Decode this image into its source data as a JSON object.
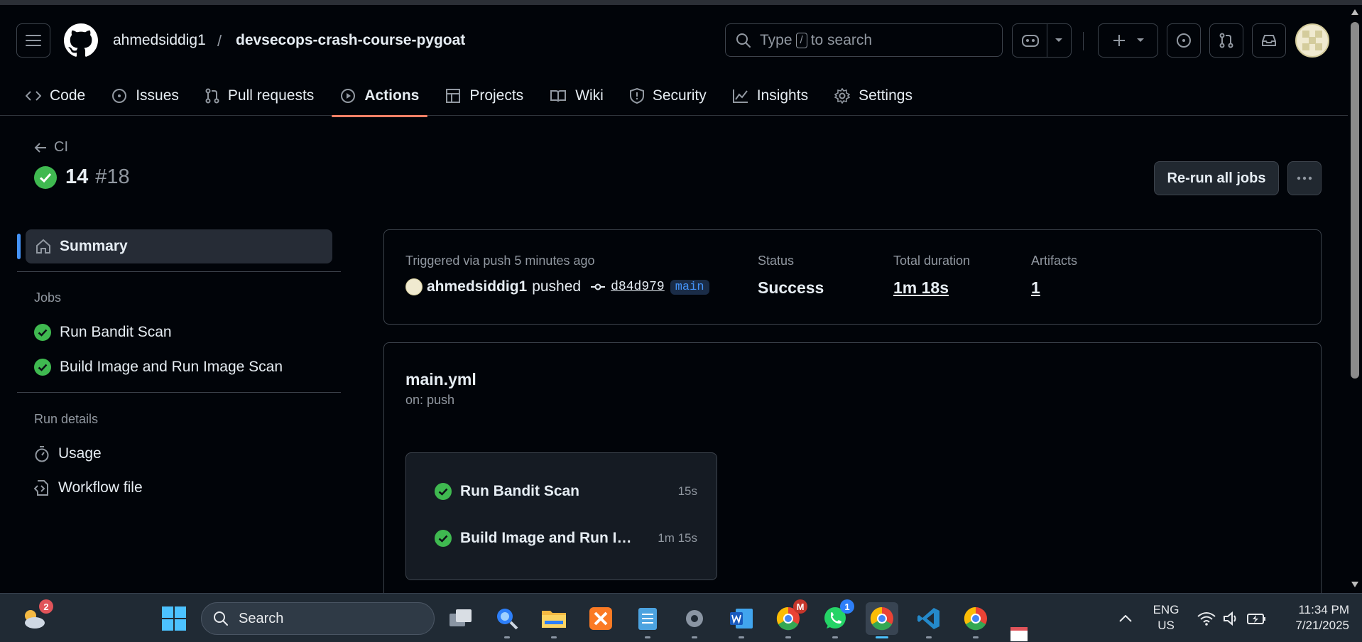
{
  "header": {
    "owner": "ahmedsiddig1",
    "separator": "/",
    "repo": "devsecops-crash-course-pygoat",
    "search_prefix": "Type",
    "search_key": "/",
    "search_suffix": "to search"
  },
  "tabs": [
    {
      "label": "Code",
      "icon": "code-icon",
      "active": false
    },
    {
      "label": "Issues",
      "icon": "issue-icon",
      "active": false
    },
    {
      "label": "Pull requests",
      "icon": "pull-request-icon",
      "active": false
    },
    {
      "label": "Actions",
      "icon": "play-icon",
      "active": true
    },
    {
      "label": "Projects",
      "icon": "table-icon",
      "active": false
    },
    {
      "label": "Wiki",
      "icon": "book-icon",
      "active": false
    },
    {
      "label": "Security",
      "icon": "shield-icon",
      "active": false
    },
    {
      "label": "Insights",
      "icon": "graph-icon",
      "active": false
    },
    {
      "label": "Settings",
      "icon": "gear-icon",
      "active": false
    }
  ],
  "run": {
    "back_label": "CI",
    "title": "14",
    "run_id": "#18",
    "rerun_label": "Re-run all jobs"
  },
  "sidebar": {
    "summary_label": "Summary",
    "jobs_heading": "Jobs",
    "jobs": [
      {
        "label": "Run Bandit Scan",
        "status": "success"
      },
      {
        "label": "Build Image and Run Image Scan",
        "status": "success"
      }
    ],
    "details_heading": "Run details",
    "usage_label": "Usage",
    "workflow_file_label": "Workflow file"
  },
  "summary_card": {
    "triggered": "Triggered via push 5 minutes ago",
    "actor": "ahmedsiddig1",
    "verb": "pushed",
    "commit": "d84d979",
    "branch": "main",
    "status_label": "Status",
    "status_value": "Success",
    "duration_label": "Total duration",
    "duration_value": "1m 18s",
    "artifacts_label": "Artifacts",
    "artifacts_value": "1"
  },
  "workflow": {
    "file": "main.yml",
    "trigger": "on: push",
    "jobs": [
      {
        "name": "Run Bandit Scan",
        "duration": "15s"
      },
      {
        "name": "Build Image and Run Image Scan",
        "duration": "1m 15s"
      }
    ]
  },
  "taskbar": {
    "weather_badge": "2",
    "search_label": "Search",
    "chrome_badge": "M",
    "whatsapp_badge": "1",
    "lang_line1": "ENG",
    "lang_line2": "US",
    "time": "11:34 PM",
    "date": "7/21/2025"
  },
  "colors": {
    "success": "#3fb950",
    "accent_underline": "#f78166",
    "link_blue": "#4493f8",
    "background": "#010409"
  }
}
